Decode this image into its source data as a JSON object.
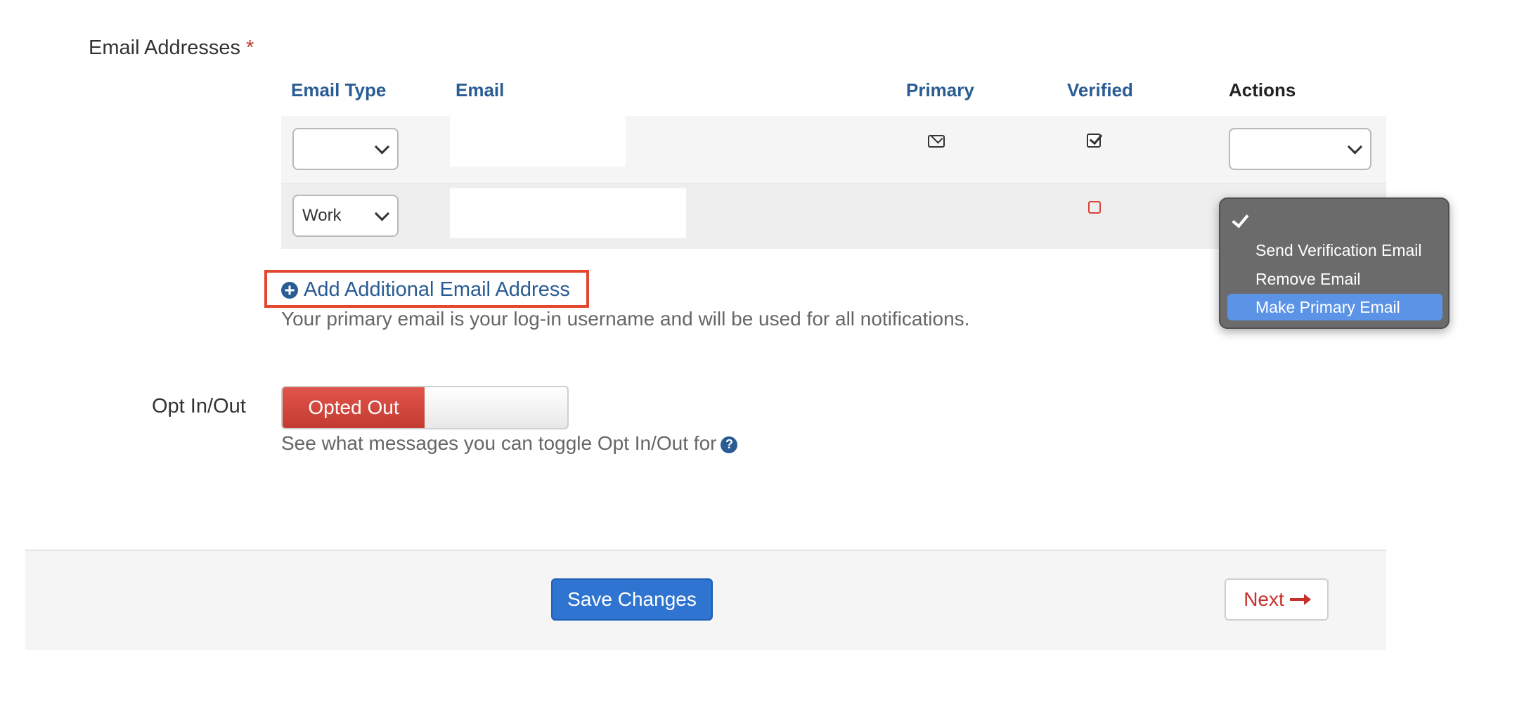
{
  "email_section": {
    "label": "Email Addresses",
    "required_marker": "*",
    "columns": {
      "email_type": "Email Type",
      "email": "Email",
      "primary": "Primary",
      "verified": "Verified",
      "actions": "Actions"
    },
    "rows": [
      {
        "email_type": "",
        "email": "",
        "primary": true,
        "verified": true,
        "action": ""
      },
      {
        "email_type": "Work",
        "email": "",
        "primary": false,
        "verified": false,
        "action": ""
      }
    ],
    "add_link": "Add Additional Email Address",
    "help_text": "Your primary email is your log-in username and will be used for all notifications."
  },
  "actions_dropdown": {
    "options": [
      "",
      "Send Verification Email",
      "Remove Email",
      "Make Primary Email"
    ],
    "highlighted": "Make Primary Email"
  },
  "opt_section": {
    "label": "Opt In/Out",
    "toggle_state": "Opted Out",
    "help_text": "See what messages you can toggle Opt In/Out for"
  },
  "footer": {
    "save_label": "Save Changes",
    "next_label": "Next"
  },
  "colors": {
    "link_blue": "#2a5c94",
    "required_red": "#c0392b",
    "highlight_red": "#e3472f",
    "save_blue": "#2f74d0",
    "opted_out_red": "#d14a40",
    "dropdown_selected": "#5b93e6"
  },
  "icons": [
    "plus-circle-icon",
    "envelope-icon",
    "checked-square-icon",
    "unchecked-square-icon",
    "question-circle-icon",
    "arrow-right-icon",
    "checkmark-icon"
  ]
}
